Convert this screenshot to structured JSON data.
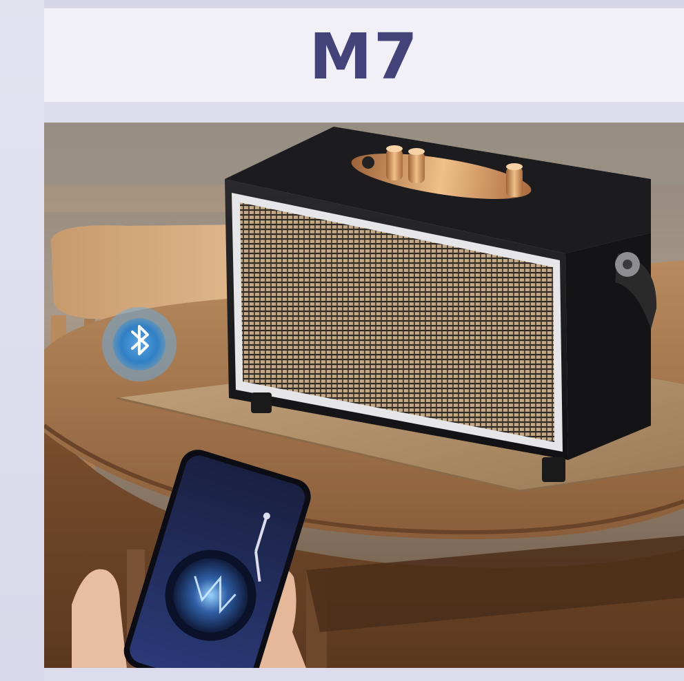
{
  "product": {
    "model_title": "M7"
  },
  "colors": {
    "title_text": "#43437a",
    "title_box": "#f1f0f7",
    "page_background": "#dcdcec",
    "bluetooth_badge": "#2f7fc4"
  },
  "photo": {
    "subject": "retro-bluetooth-speaker-on-table-with-phone",
    "icons": [
      "bluetooth-icon"
    ]
  }
}
